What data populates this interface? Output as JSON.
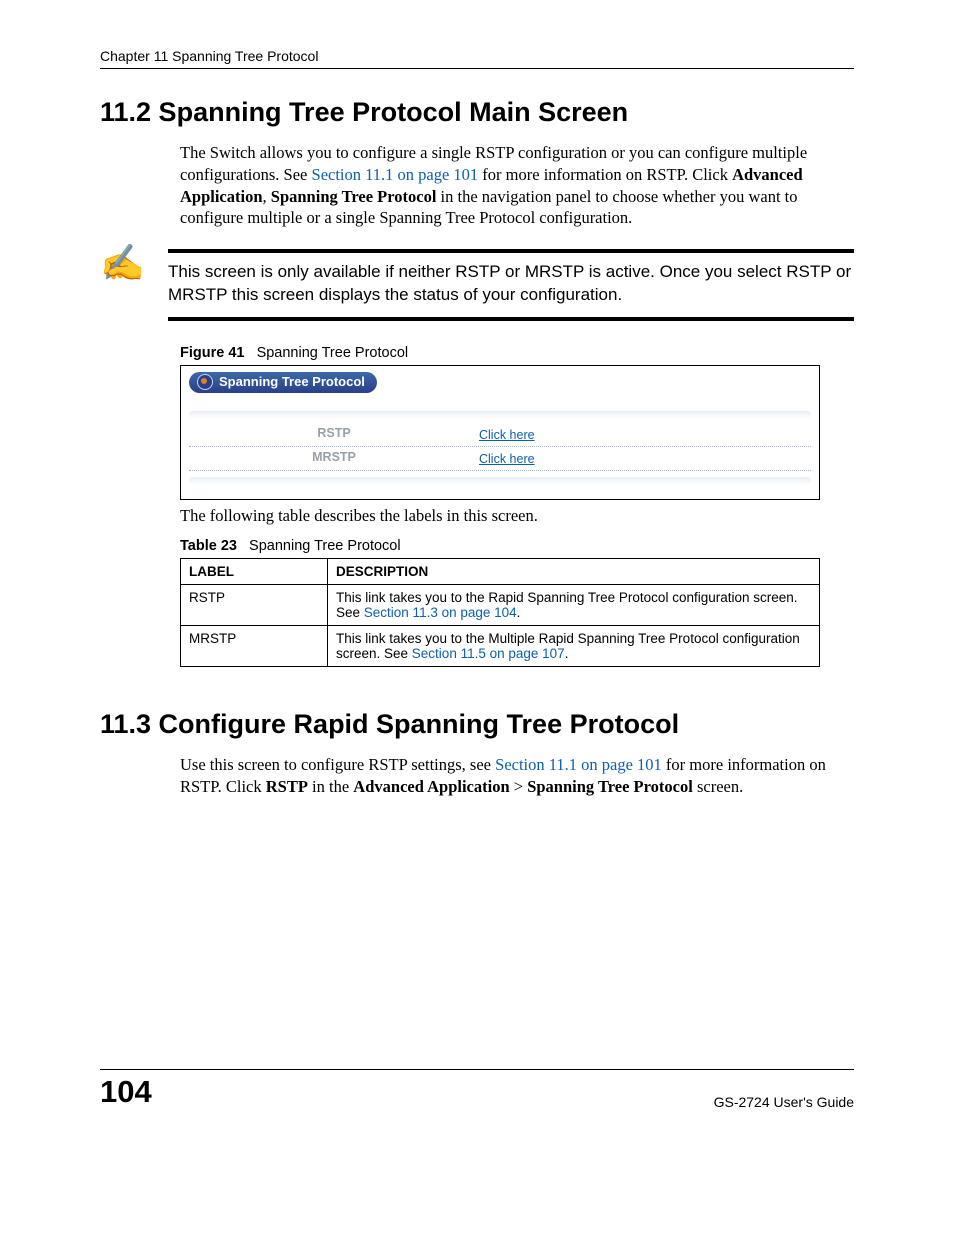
{
  "header": {
    "chapter_line": "Chapter 11 Spanning Tree Protocol"
  },
  "s112": {
    "title": "11.2  Spanning Tree Protocol Main Screen",
    "para_parts": {
      "p1": "The Switch allows you to configure a single RSTP configuration or you can configure multiple configurations. See ",
      "link1": "Section 11.1 on page 101",
      "p2": " for more information on RSTP. Click ",
      "bold1": "Advanced Application",
      "p3": ", ",
      "bold2": "Spanning Tree Protocol",
      "p4": " in the navigation panel to choose whether you want to configure multiple or a single Spanning Tree Protocol configuration."
    }
  },
  "note": {
    "text": "This screen is only available if neither RSTP or MRSTP is active. Once you select RSTP or MRSTP this screen displays the status of your configuration."
  },
  "figure41": {
    "label": "Figure 41",
    "title": "Spanning Tree Protocol",
    "screenshot": {
      "title": "Spanning Tree Protocol",
      "rows": [
        {
          "label": "RSTP",
          "link": "Click here"
        },
        {
          "label": "MRSTP",
          "link": "Click here"
        }
      ]
    }
  },
  "table_intro": "The following table describes the labels in this screen.",
  "table23": {
    "label": "Table 23",
    "title": "Spanning Tree Protocol",
    "headers": {
      "col1": "LABEL",
      "col2": "DESCRIPTION"
    },
    "rows": [
      {
        "label": "RSTP",
        "desc_pre": "This link takes you to the Rapid Spanning Tree Protocol configuration screen. See ",
        "desc_link": "Section 11.3 on page 104",
        "desc_post": "."
      },
      {
        "label": "MRSTP",
        "desc_pre": "This link takes you to the Multiple Rapid Spanning Tree Protocol configuration screen. See ",
        "desc_link": "Section 11.5 on page 107",
        "desc_post": "."
      }
    ]
  },
  "s113": {
    "title": "11.3  Configure Rapid Spanning Tree Protocol",
    "para_parts": {
      "p1": "Use this screen to configure RSTP settings, see ",
      "link1": "Section 11.1 on page 101",
      "p2": " for more information on RSTP. Click ",
      "bold1": "RSTP",
      "p3": " in the ",
      "bold2": "Advanced Application",
      "p4": " > ",
      "bold3": "Spanning Tree Protocol",
      "p5": " screen."
    }
  },
  "footer": {
    "page_number": "104",
    "guide": "GS-2724 User's Guide"
  }
}
